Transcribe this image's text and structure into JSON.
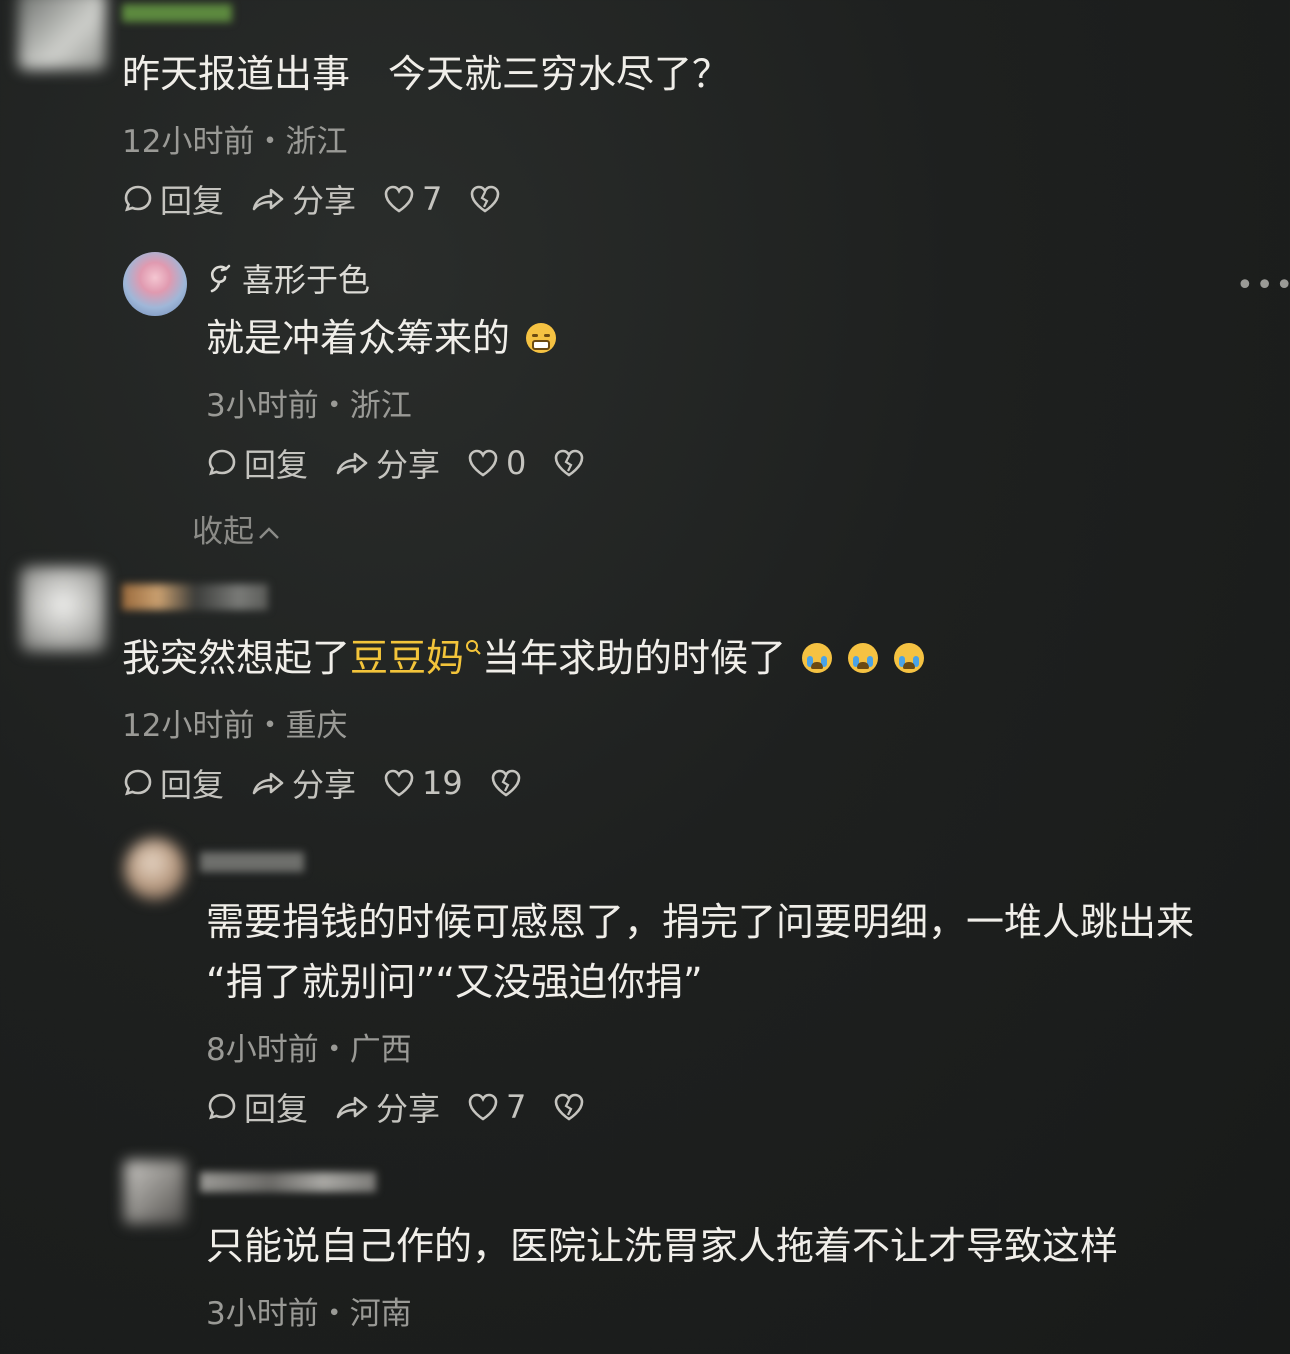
{
  "icons": {
    "reply": "comment-bubble-icon",
    "share": "share-arrow-icon",
    "like": "heart-icon",
    "dislike": "broken-heart-icon",
    "more": "more-dots-icon",
    "search": "search-icon"
  },
  "actions": {
    "reply": "回复",
    "share": "分享"
  },
  "comments": [
    {
      "text": "昨天报道出事　今天就三穷水尽了？",
      "meta": "12小时前・浙江",
      "likes": "7",
      "replies": [
        {
          "username": "喜形于色",
          "text": "就是冲着众筹来的",
          "meta": "3小时前・浙江",
          "likes": "0"
        }
      ],
      "collapse_label": "收起"
    },
    {
      "text_before": "我突然想起了",
      "text_link": "豆豆妈",
      "text_after": "当年求助的时候了",
      "meta": "12小时前・重庆",
      "likes": "19",
      "replies": [
        {
          "text_line1": "需要捐钱的时候可感恩了，捐完了问要明细，一堆人跳出来",
          "text_line2": "“捐了就别问”“又没强迫你捐”",
          "meta": "8小时前・广西",
          "likes": "7"
        },
        {
          "text": "只能说自己作的，医院让洗胃家人拖着不让才导致这样",
          "meta": "3小时前・河南"
        }
      ]
    }
  ],
  "colors": {
    "background": "#1e201f",
    "highlight": "#f3c43a",
    "meta": "#9a9a96"
  }
}
